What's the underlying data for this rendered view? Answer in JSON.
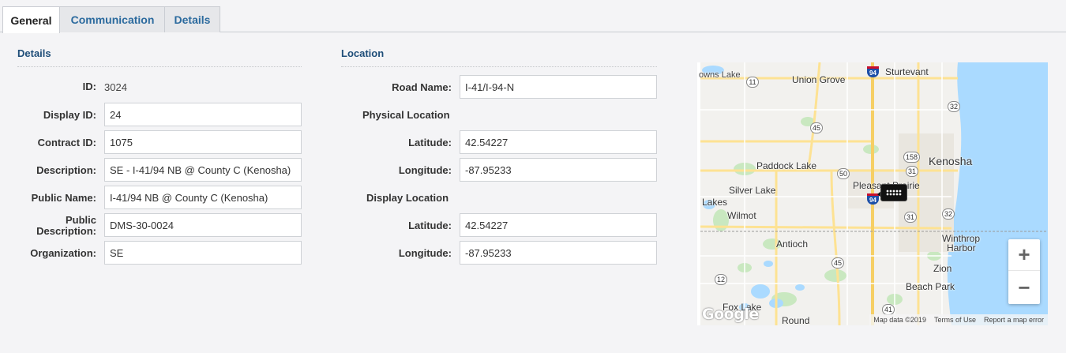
{
  "tabs": [
    "General",
    "Communication",
    "Details"
  ],
  "details": {
    "title": "Details",
    "id_label": "ID:",
    "id_value": "3024",
    "display_id_label": "Display ID:",
    "display_id_value": "24",
    "contract_id_label": "Contract ID:",
    "contract_id_value": "1075",
    "description_label": "Description:",
    "description_value": "SE - I-41/94 NB @ County C (Kenosha)",
    "public_name_label": "Public Name:",
    "public_name_value": "I-41/94 NB @ County C (Kenosha)",
    "public_description_label_1": "Public",
    "public_description_label_2": "Description:",
    "public_description_value": "DMS-30-0024",
    "organization_label": "Organization:",
    "organization_value": "SE"
  },
  "location": {
    "title": "Location",
    "road_name_label": "Road Name:",
    "road_name_value": "I-41/I-94-N",
    "physical_location_label": "Physical Location",
    "physical_latitude_label": "Latitude:",
    "physical_latitude_value": "42.54227",
    "physical_longitude_label": "Longitude:",
    "physical_longitude_value": "-87.95233",
    "display_location_label": "Display Location",
    "display_latitude_label": "Latitude:",
    "display_latitude_value": "42.54227",
    "display_longitude_label": "Longitude:",
    "display_longitude_value": "-87.95233"
  },
  "map": {
    "places": [
      "owns Lake",
      "Union Grove",
      "Sturtevant",
      "Kenosha",
      "Paddock Lake",
      "Pleasant Prairie",
      "Silver Lake",
      "Lakes",
      "Wilmot",
      "Antioch",
      "Winthrop",
      "Harbor",
      "Zion",
      "Beach Park",
      "Fox Lake",
      "Round"
    ],
    "shields": [
      "11",
      "45",
      "158",
      "32",
      "50",
      "31",
      "31",
      "32",
      "45",
      "12",
      "41"
    ],
    "interstate": "94",
    "zoom_in": "+",
    "zoom_out": "−",
    "google": "Google",
    "map_data": "Map data ©2019",
    "terms": "Terms of Use",
    "report": "Report a map error",
    "colors": {
      "water": "#aadaff",
      "land": "#f2f1ee",
      "road": "#fde293",
      "park": "#c9e8c0"
    }
  }
}
